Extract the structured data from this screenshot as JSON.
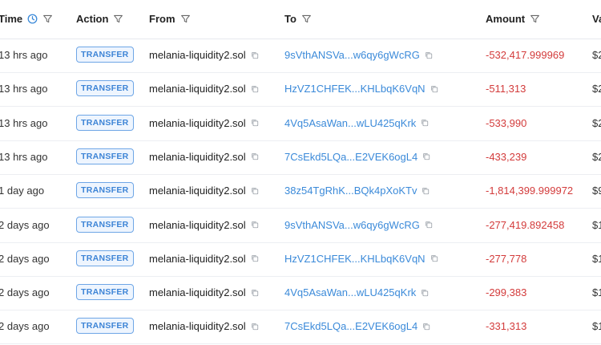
{
  "headers": {
    "time": "Time",
    "action": "Action",
    "from": "From",
    "to": "To",
    "amount": "Amount",
    "value": "Va"
  },
  "rows": [
    {
      "time": "13 hrs ago",
      "action": "TRANSFER",
      "from": "melania-liquidity2.sol",
      "to": "9sVthANSVa...w6qy6gWcRG",
      "amount": "-532,417.999969",
      "value": "$2"
    },
    {
      "time": "13 hrs ago",
      "action": "TRANSFER",
      "from": "melania-liquidity2.sol",
      "to": "HzVZ1CHFEK...KHLbqK6VqN",
      "amount": "-511,313",
      "value": "$2"
    },
    {
      "time": "13 hrs ago",
      "action": "TRANSFER",
      "from": "melania-liquidity2.sol",
      "to": "4Vq5AsaWan...wLU425qKrk",
      "amount": "-533,990",
      "value": "$2"
    },
    {
      "time": "13 hrs ago",
      "action": "TRANSFER",
      "from": "melania-liquidity2.sol",
      "to": "7CsEkd5LQa...E2VEK6ogL4",
      "amount": "-433,239",
      "value": "$2"
    },
    {
      "time": "1 day ago",
      "action": "TRANSFER",
      "from": "melania-liquidity2.sol",
      "to": "38z54TgRhK...BQk4pXoKTv",
      "amount": "-1,814,399.999972",
      "value": "$9"
    },
    {
      "time": "2 days ago",
      "action": "TRANSFER",
      "from": "melania-liquidity2.sol",
      "to": "9sVthANSVa...w6qy6gWcRG",
      "amount": "-277,419.892458",
      "value": "$1"
    },
    {
      "time": "2 days ago",
      "action": "TRANSFER",
      "from": "melania-liquidity2.sol",
      "to": "HzVZ1CHFEK...KHLbqK6VqN",
      "amount": "-277,778",
      "value": "$1"
    },
    {
      "time": "2 days ago",
      "action": "TRANSFER",
      "from": "melania-liquidity2.sol",
      "to": "4Vq5AsaWan...wLU425qKrk",
      "amount": "-299,383",
      "value": "$1"
    },
    {
      "time": "2 days ago",
      "action": "TRANSFER",
      "from": "melania-liquidity2.sol",
      "to": "7CsEkd5LQa...E2VEK6ogL4",
      "amount": "-331,313",
      "value": "$1"
    }
  ],
  "colors": {
    "link": "#3b8ad9",
    "negative": "#d33b3b",
    "badge_border": "#6ea6e6",
    "badge_bg": "#eef5fe"
  },
  "icons": {
    "clock": "clock-icon",
    "filter": "filter-icon",
    "copy": "copy-icon"
  }
}
